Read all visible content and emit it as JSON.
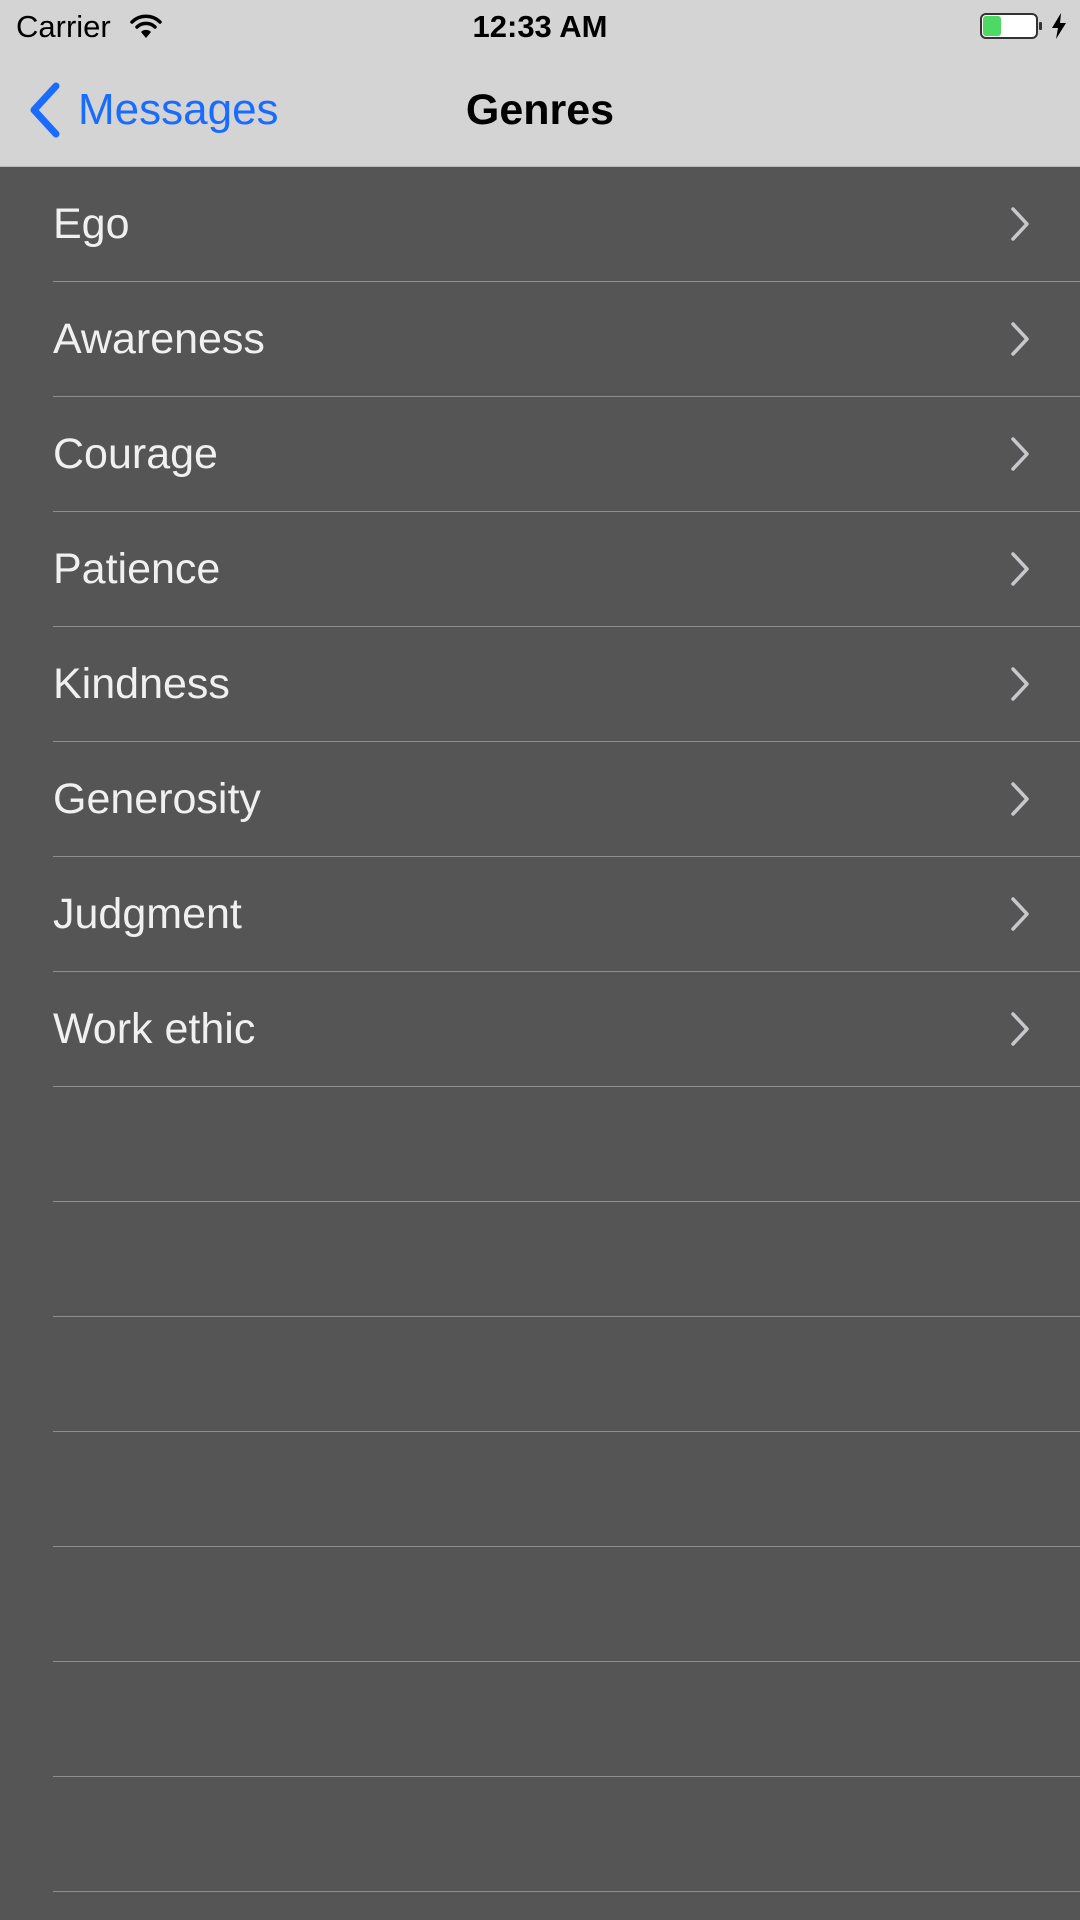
{
  "status_bar": {
    "carrier": "Carrier",
    "time": "12:33 AM",
    "battery_color": "#4cd964"
  },
  "nav": {
    "back_label": "Messages",
    "title": "Genres",
    "accent_color": "#1a6cff"
  },
  "genres": [
    {
      "label": "Ego"
    },
    {
      "label": "Awareness"
    },
    {
      "label": "Courage"
    },
    {
      "label": "Patience"
    },
    {
      "label": "Kindness"
    },
    {
      "label": "Generosity"
    },
    {
      "label": "Judgment"
    },
    {
      "label": "Work ethic"
    }
  ],
  "icons": {
    "wifi": "wifi-icon",
    "battery": "battery-icon",
    "charging": "charging-bolt-icon",
    "back": "chevron-left-icon",
    "disclosure": "chevron-right-icon"
  }
}
